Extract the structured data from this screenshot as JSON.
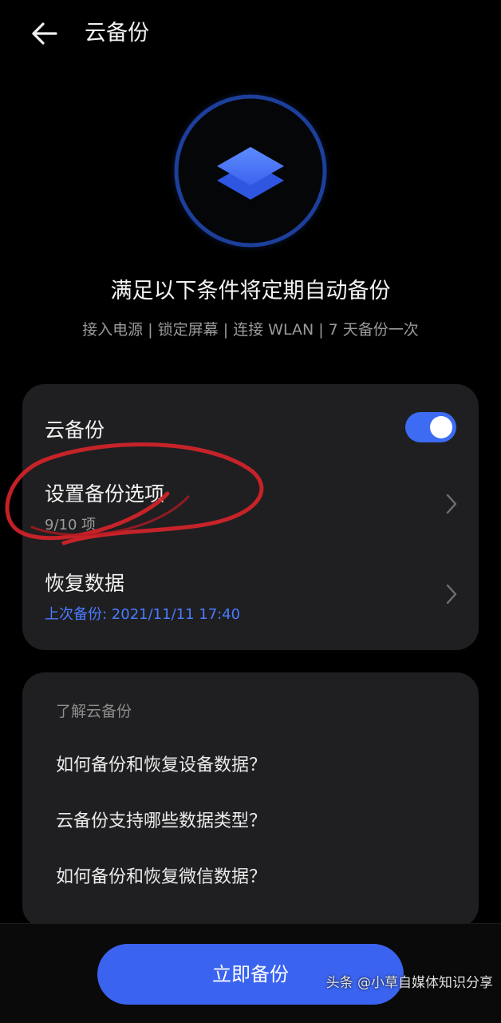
{
  "header": {
    "title": "云备份"
  },
  "hero": {
    "headline": "满足以下条件将定期自动备份",
    "conditions": "接入电源 | 锁定屏幕 | 连接 WLAN | 7 天备份一次"
  },
  "settings": {
    "cloud_backup_label": "云备份",
    "cloud_backup_enabled": true,
    "backup_options_label": "设置备份选项",
    "backup_options_count": "9/10 项",
    "restore_label": "恢复数据",
    "last_backup": "上次备份: 2021/11/11 17:40"
  },
  "learn": {
    "heading": "了解云备份",
    "items": [
      "如何备份和恢复设备数据？",
      "云备份支持哪些数据类型？",
      "如何备份和恢复微信数据？"
    ]
  },
  "actions": {
    "backup_now": "立即备份"
  },
  "watermark": "头条 @小草自媒体知识分享",
  "colors": {
    "accent": "#3a63f0",
    "link_blue": "#4a7bff",
    "card_bg": "#1f1f21",
    "annotation_red": "#d8232a"
  }
}
